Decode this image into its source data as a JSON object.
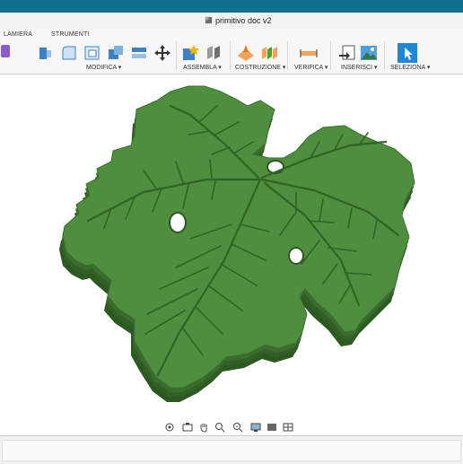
{
  "window": {
    "title": "primitivo doc v2"
  },
  "ribbon": {
    "tabs": {
      "lamiera": "LAMIERA",
      "strumenti": "STRUMENTI"
    },
    "groups": {
      "modifica": "MODIFICA ▾",
      "assembla": "ASSEMBLA ▾",
      "costruzione": "COSTRUZIONE ▾",
      "verifica": "VERIFICA ▾",
      "inserisci": "INSERISCI ▾",
      "seleziona": "SELEZIONA ▾"
    }
  },
  "colors": {
    "leaf_top": "#4f8e3f",
    "leaf_side": "#2f5e24",
    "leaf_vein": "#2f6426",
    "accent": "#0f6f8c",
    "select_blue": "#1e88d6"
  },
  "icons": [
    "sheetmetal-icon",
    "press-pull-icon",
    "fillet-icon",
    "shell-icon",
    "combine-icon",
    "move-icon",
    "new-component-icon",
    "joint-icon",
    "plane-icon",
    "midplane-icon",
    "measure-icon",
    "insert-derive-icon",
    "insert-image-icon",
    "select-icon",
    "orbit-icon",
    "look-at-icon",
    "pan-icon",
    "zoom-icon",
    "zoom-window-icon",
    "display-settings-icon",
    "grid-settings-icon",
    "viewports-icon"
  ]
}
